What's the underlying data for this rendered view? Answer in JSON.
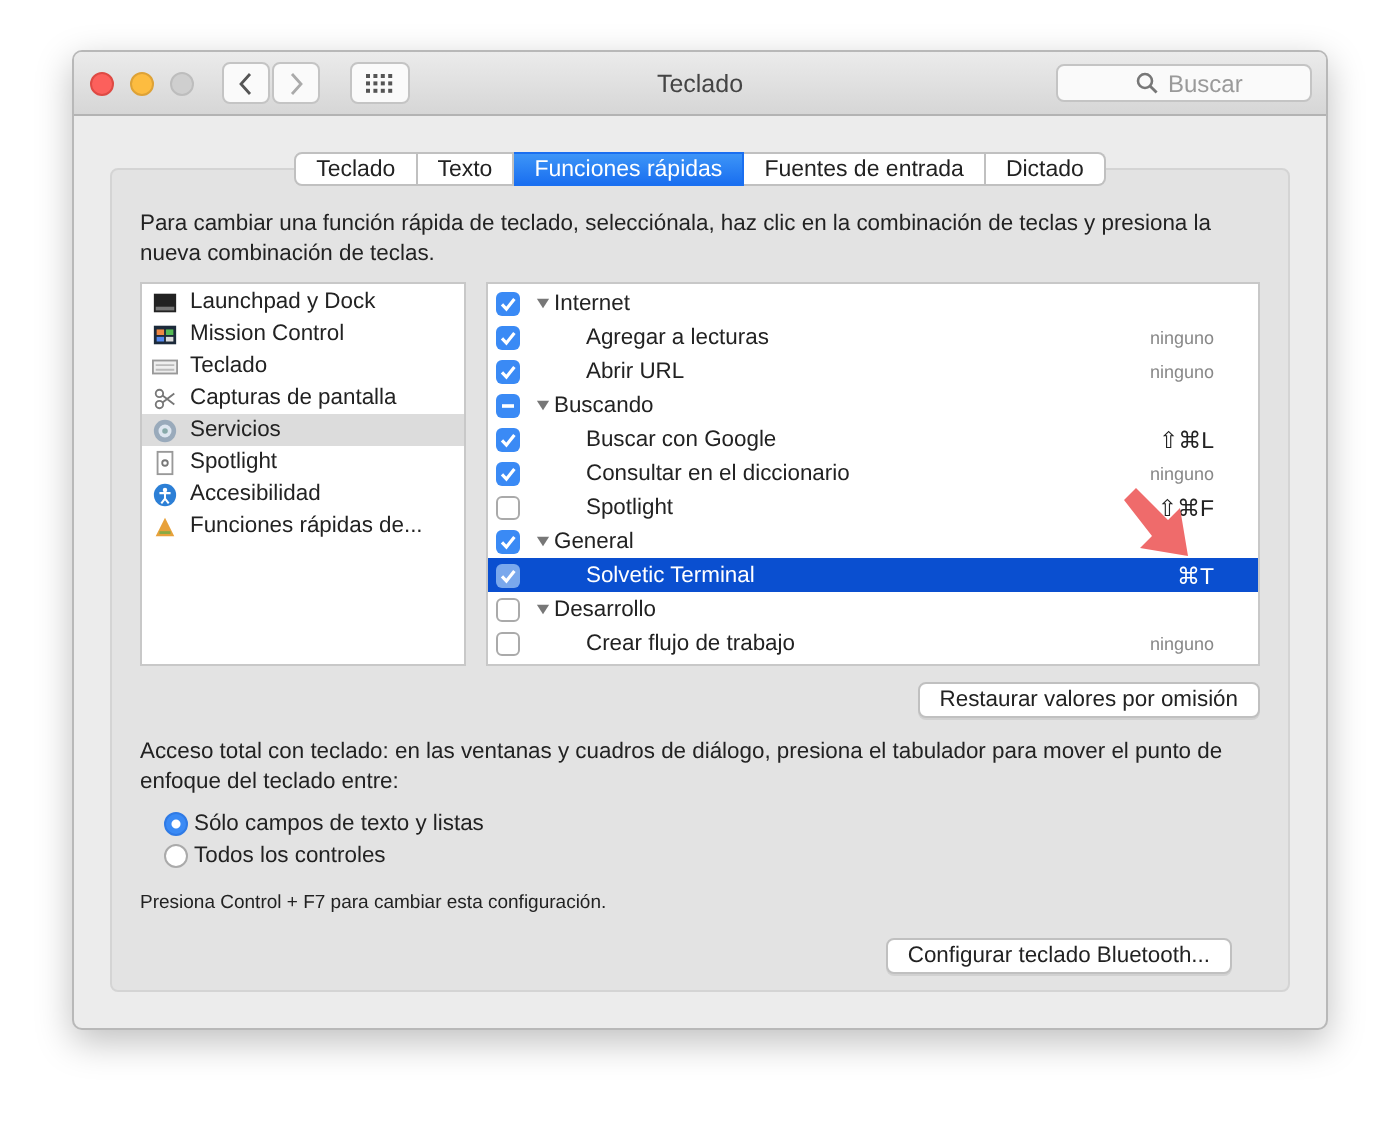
{
  "window": {
    "title": "Teclado"
  },
  "search": {
    "placeholder": "Buscar"
  },
  "tabs": [
    {
      "label": "Teclado",
      "selected": false
    },
    {
      "label": "Texto",
      "selected": false
    },
    {
      "label": "Funciones rápidas",
      "selected": true
    },
    {
      "label": "Fuentes de entrada",
      "selected": false
    },
    {
      "label": "Dictado",
      "selected": false
    }
  ],
  "instructions": "Para cambiar una función rápida de teclado, selecciónala, haz clic en la combinación de teclas y presiona la nueva combinación de teclas.",
  "categories": [
    {
      "label": "Launchpad y Dock",
      "selected": false
    },
    {
      "label": "Mission Control",
      "selected": false
    },
    {
      "label": "Teclado",
      "selected": false
    },
    {
      "label": "Capturas de pantalla",
      "selected": false
    },
    {
      "label": "Servicios",
      "selected": true
    },
    {
      "label": "Spotlight",
      "selected": false
    },
    {
      "label": "Accesibilidad",
      "selected": false
    },
    {
      "label": "Funciones rápidas de...",
      "selected": false
    }
  ],
  "shortcuts": [
    {
      "label": "Internet",
      "checked": true,
      "expanded": true,
      "children": [
        {
          "label": "Agregar a lecturas",
          "shortcut": "ninguno",
          "checked": true,
          "selected": false
        },
        {
          "label": "Abrir URL",
          "shortcut": "ninguno",
          "checked": true,
          "selected": false
        }
      ]
    },
    {
      "label": "Buscando",
      "mixed": true,
      "expanded": true,
      "children": [
        {
          "label": "Buscar con Google",
          "shortcut": "⇧⌘L",
          "checked": true,
          "selected": false
        },
        {
          "label": "Consultar en el diccionario",
          "shortcut": "ninguno",
          "checked": true,
          "selected": false
        },
        {
          "label": "Spotlight",
          "shortcut": "⇧⌘F",
          "checked": false,
          "selected": false
        }
      ]
    },
    {
      "label": "General",
      "checked": true,
      "expanded": true,
      "children": [
        {
          "label": "Solvetic Terminal",
          "shortcut": "⌘T",
          "checked": true,
          "selected": true
        }
      ]
    },
    {
      "label": "Desarrollo",
      "checked": false,
      "expanded": true,
      "children": [
        {
          "label": "Crear flujo de trabajo",
          "shortcut": "ninguno",
          "checked": false,
          "selected": false
        }
      ]
    }
  ],
  "restore_button": "Restaurar valores por omisión",
  "access_text": "Acceso total con teclado: en las ventanas y cuadros de diálogo, presiona el tabulador para mover el punto de enfoque del teclado entre:",
  "access_options": [
    {
      "label": "Sólo campos de texto y listas",
      "selected": true
    },
    {
      "label": "Todos los controles",
      "selected": false
    }
  ],
  "hint": "Presiona Control + F7 para cambiar esta configuración.",
  "bluetooth_button": "Configurar teclado Bluetooth..."
}
